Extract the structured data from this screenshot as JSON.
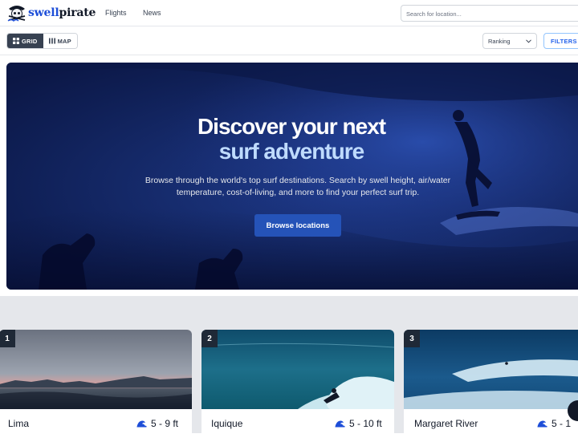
{
  "header": {
    "logo_part1": "swell",
    "logo_part2": "pirate",
    "nav": [
      {
        "label": "Flights"
      },
      {
        "label": "News"
      }
    ],
    "search_placeholder": "Search for location..."
  },
  "toolbar": {
    "grid_label": "GRID",
    "map_label": "MAP",
    "sort_value": "Ranking",
    "filters_label": "FILTERS"
  },
  "hero": {
    "title_line1": "Discover your next",
    "title_line2": "surf adventure",
    "description": "Browse through the world's top surf destinations. Search by swell height, air/water temperature, cost-of-living, and more to find your perfect surf trip.",
    "button_label": "Browse locations"
  },
  "cards": [
    {
      "rank": "1",
      "name": "Lima",
      "swell": "5 - 9 ft"
    },
    {
      "rank": "2",
      "name": "Iquique",
      "swell": "5 - 10 ft"
    },
    {
      "rank": "3",
      "name": "Margaret River",
      "swell": "5 - 1"
    }
  ],
  "colors": {
    "brand_blue": "#1d4ed8",
    "hero_button": "#2553b8",
    "dark": "#1f2937"
  }
}
